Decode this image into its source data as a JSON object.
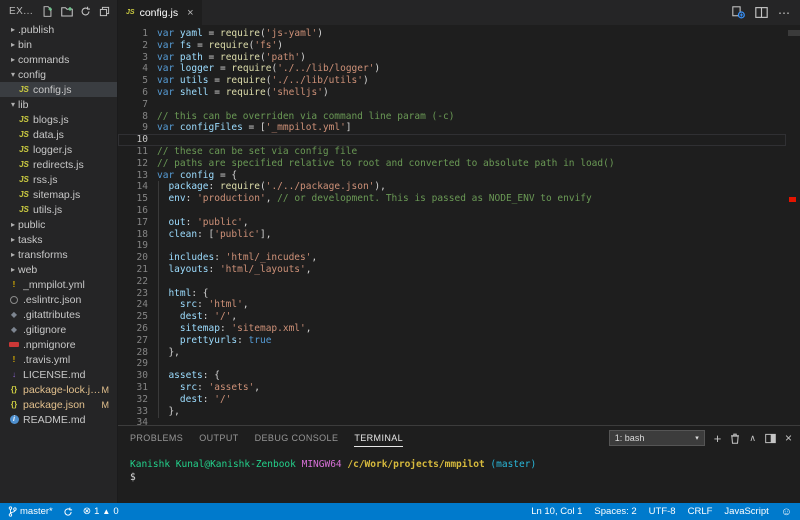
{
  "explorer": {
    "title": "EX...",
    "actions": [
      {
        "name": "new-file-icon"
      },
      {
        "name": "new-folder-icon"
      },
      {
        "name": "refresh-explorer-icon"
      },
      {
        "name": "collapse-folders-icon"
      }
    ],
    "files": [
      {
        "label": ".publish",
        "icon": "folder",
        "chevron": "right",
        "indent": 0
      },
      {
        "label": "bin",
        "icon": "folder",
        "chevron": "right",
        "indent": 0
      },
      {
        "label": "commands",
        "icon": "folder",
        "chevron": "right",
        "indent": 0
      },
      {
        "label": "config",
        "icon": "folder",
        "chevron": "down",
        "indent": 0
      },
      {
        "label": "config.js",
        "icon": "js-icon",
        "indent": 1,
        "selected": true
      },
      {
        "label": "lib",
        "icon": "folder",
        "chevron": "down",
        "indent": 0
      },
      {
        "label": "blogs.js",
        "icon": "js-icon",
        "indent": 1
      },
      {
        "label": "data.js",
        "icon": "js-icon",
        "indent": 1
      },
      {
        "label": "logger.js",
        "icon": "js-icon",
        "indent": 1
      },
      {
        "label": "redirects.js",
        "icon": "js-icon",
        "indent": 1
      },
      {
        "label": "rss.js",
        "icon": "js-icon",
        "indent": 1
      },
      {
        "label": "sitemap.js",
        "icon": "js-icon",
        "indent": 1
      },
      {
        "label": "utils.js",
        "icon": "js-icon",
        "indent": 1
      },
      {
        "label": "public",
        "icon": "folder",
        "chevron": "right",
        "indent": 0
      },
      {
        "label": "tasks",
        "icon": "folder",
        "chevron": "right",
        "indent": 0
      },
      {
        "label": "transforms",
        "icon": "folder",
        "chevron": "right",
        "indent": 0
      },
      {
        "label": "web",
        "icon": "folder",
        "chevron": "right",
        "indent": 0
      },
      {
        "label": "_mmpilot.yml",
        "icon": "warning-icon",
        "indent": 0
      },
      {
        "label": ".eslintrc.json",
        "icon": "gear-icon",
        "indent": 0
      },
      {
        "label": ".gitattributes",
        "icon": "diamond-icon",
        "indent": 0
      },
      {
        "label": ".gitignore",
        "icon": "diamond-icon",
        "indent": 0
      },
      {
        "label": ".npmignore",
        "icon": "npm-icon",
        "indent": 0
      },
      {
        "label": ".travis.yml",
        "icon": "warning-icon",
        "indent": 0
      },
      {
        "label": "LICENSE.md",
        "icon": "license-icon",
        "indent": 0
      },
      {
        "label": "package-lock.json",
        "icon": "braces-icon",
        "indent": 0,
        "badge": "M",
        "modified": true
      },
      {
        "label": "package.json",
        "icon": "braces-icon",
        "indent": 0,
        "badge": "M",
        "modified": true
      },
      {
        "label": "README.md",
        "icon": "info-icon",
        "indent": 0
      }
    ]
  },
  "editor": {
    "tab": {
      "label": "config.js",
      "icon": "js-icon",
      "close": "×"
    },
    "actions": [
      {
        "name": "open-changes-icon"
      },
      {
        "name": "split-editor-icon"
      },
      {
        "name": "more-actions-icon",
        "glyph": "⋯"
      }
    ],
    "current_line": 10,
    "lines": [
      {
        "n": 1,
        "t": [
          [
            "kw",
            "var"
          ],
          [
            "pn",
            " "
          ],
          [
            "var",
            "yaml"
          ],
          [
            "pn",
            " = "
          ],
          [
            "fn",
            "require"
          ],
          [
            "pn",
            "("
          ],
          [
            "str",
            "'js-yaml'"
          ],
          [
            "pn",
            ")"
          ]
        ]
      },
      {
        "n": 2,
        "t": [
          [
            "kw",
            "var"
          ],
          [
            "pn",
            " "
          ],
          [
            "var",
            "fs"
          ],
          [
            "pn",
            " = "
          ],
          [
            "fn",
            "require"
          ],
          [
            "pn",
            "("
          ],
          [
            "str",
            "'fs'"
          ],
          [
            "pn",
            ")"
          ]
        ]
      },
      {
        "n": 3,
        "t": [
          [
            "kw",
            "var"
          ],
          [
            "pn",
            " "
          ],
          [
            "var",
            "path"
          ],
          [
            "pn",
            " = "
          ],
          [
            "fn",
            "require"
          ],
          [
            "pn",
            "("
          ],
          [
            "str",
            "'path'"
          ],
          [
            "pn",
            ")"
          ]
        ]
      },
      {
        "n": 4,
        "t": [
          [
            "kw",
            "var"
          ],
          [
            "pn",
            " "
          ],
          [
            "var",
            "logger"
          ],
          [
            "pn",
            " = "
          ],
          [
            "fn",
            "require"
          ],
          [
            "pn",
            "("
          ],
          [
            "str",
            "'./../lib/logger'"
          ],
          [
            "pn",
            ")"
          ]
        ]
      },
      {
        "n": 5,
        "t": [
          [
            "kw",
            "var"
          ],
          [
            "pn",
            " "
          ],
          [
            "var",
            "utils"
          ],
          [
            "pn",
            " = "
          ],
          [
            "fn",
            "require"
          ],
          [
            "pn",
            "("
          ],
          [
            "str",
            "'./../lib/utils'"
          ],
          [
            "pn",
            ")"
          ]
        ]
      },
      {
        "n": 6,
        "t": [
          [
            "kw",
            "var"
          ],
          [
            "pn",
            " "
          ],
          [
            "var",
            "shell"
          ],
          [
            "pn",
            " = "
          ],
          [
            "fn",
            "require"
          ],
          [
            "pn",
            "("
          ],
          [
            "str",
            "'shelljs'"
          ],
          [
            "pn",
            ")"
          ]
        ]
      },
      {
        "n": 7,
        "t": []
      },
      {
        "n": 8,
        "t": [
          [
            "cm",
            "// this can be overriden via command line param (-c)"
          ]
        ]
      },
      {
        "n": 9,
        "t": [
          [
            "kw",
            "var"
          ],
          [
            "pn",
            " "
          ],
          [
            "var",
            "configFiles"
          ],
          [
            "pn",
            " = ["
          ],
          [
            "str",
            "'_mmpilot.yml'"
          ],
          [
            "pn",
            "]"
          ]
        ]
      },
      {
        "n": 10,
        "t": []
      },
      {
        "n": 11,
        "t": [
          [
            "cm",
            "// these can be set via config file"
          ]
        ]
      },
      {
        "n": 12,
        "t": [
          [
            "cm",
            "// paths are specified relative to root and converted to absolute path in load()"
          ]
        ]
      },
      {
        "n": 13,
        "t": [
          [
            "kw",
            "var"
          ],
          [
            "pn",
            " "
          ],
          [
            "var",
            "config"
          ],
          [
            "pn",
            " = {"
          ]
        ]
      },
      {
        "n": 14,
        "t": [
          [
            "pn",
            "  "
          ],
          [
            "var",
            "package"
          ],
          [
            "pn",
            ": "
          ],
          [
            "fn",
            "require"
          ],
          [
            "pn",
            "("
          ],
          [
            "str",
            "'./../package.json'"
          ],
          [
            "pn",
            "),"
          ]
        ]
      },
      {
        "n": 15,
        "t": [
          [
            "pn",
            "  "
          ],
          [
            "var",
            "env"
          ],
          [
            "pn",
            ": "
          ],
          [
            "str",
            "'production'"
          ],
          [
            "pn",
            ", "
          ],
          [
            "cm",
            "// or development. This is passed as NODE_ENV to envify"
          ]
        ]
      },
      {
        "n": 16,
        "t": []
      },
      {
        "n": 17,
        "t": [
          [
            "pn",
            "  "
          ],
          [
            "var",
            "out"
          ],
          [
            "pn",
            ": "
          ],
          [
            "str",
            "'public'"
          ],
          [
            "pn",
            ","
          ]
        ]
      },
      {
        "n": 18,
        "t": [
          [
            "pn",
            "  "
          ],
          [
            "var",
            "clean"
          ],
          [
            "pn",
            ": ["
          ],
          [
            "str",
            "'public'"
          ],
          [
            "pn",
            "],"
          ]
        ]
      },
      {
        "n": 19,
        "t": []
      },
      {
        "n": 20,
        "t": [
          [
            "pn",
            "  "
          ],
          [
            "var",
            "includes"
          ],
          [
            "pn",
            ": "
          ],
          [
            "str",
            "'html/_incudes'"
          ],
          [
            "pn",
            ","
          ]
        ]
      },
      {
        "n": 21,
        "t": [
          [
            "pn",
            "  "
          ],
          [
            "var",
            "layouts"
          ],
          [
            "pn",
            ": "
          ],
          [
            "str",
            "'html/_layouts'"
          ],
          [
            "pn",
            ","
          ]
        ]
      },
      {
        "n": 22,
        "t": []
      },
      {
        "n": 23,
        "t": [
          [
            "pn",
            "  "
          ],
          [
            "var",
            "html"
          ],
          [
            "pn",
            ": {"
          ]
        ]
      },
      {
        "n": 24,
        "t": [
          [
            "pn",
            "    "
          ],
          [
            "var",
            "src"
          ],
          [
            "pn",
            ": "
          ],
          [
            "str",
            "'html'"
          ],
          [
            "pn",
            ","
          ]
        ]
      },
      {
        "n": 25,
        "t": [
          [
            "pn",
            "    "
          ],
          [
            "var",
            "dest"
          ],
          [
            "pn",
            ": "
          ],
          [
            "str",
            "'/'"
          ],
          [
            "pn",
            ","
          ]
        ]
      },
      {
        "n": 26,
        "t": [
          [
            "pn",
            "    "
          ],
          [
            "var",
            "sitemap"
          ],
          [
            "pn",
            ": "
          ],
          [
            "str",
            "'sitemap.xml'"
          ],
          [
            "pn",
            ","
          ]
        ]
      },
      {
        "n": 27,
        "t": [
          [
            "pn",
            "    "
          ],
          [
            "var",
            "prettyurls"
          ],
          [
            "pn",
            ": "
          ],
          [
            "kw",
            "true"
          ]
        ]
      },
      {
        "n": 28,
        "t": [
          [
            "pn",
            "  },"
          ]
        ]
      },
      {
        "n": 29,
        "t": []
      },
      {
        "n": 30,
        "t": [
          [
            "pn",
            "  "
          ],
          [
            "var",
            "assets"
          ],
          [
            "pn",
            ": {"
          ]
        ]
      },
      {
        "n": 31,
        "t": [
          [
            "pn",
            "    "
          ],
          [
            "var",
            "src"
          ],
          [
            "pn",
            ": "
          ],
          [
            "str",
            "'assets'"
          ],
          [
            "pn",
            ","
          ]
        ]
      },
      {
        "n": 32,
        "t": [
          [
            "pn",
            "    "
          ],
          [
            "var",
            "dest"
          ],
          [
            "pn",
            ": "
          ],
          [
            "str",
            "'/'"
          ]
        ]
      },
      {
        "n": 33,
        "t": [
          [
            "pn",
            "  },"
          ]
        ]
      },
      {
        "n": 34,
        "t": []
      }
    ]
  },
  "panel": {
    "tabs": [
      "PROBLEMS",
      "OUTPUT",
      "DEBUG CONSOLE",
      "TERMINAL"
    ],
    "active_tab": "TERMINAL",
    "shell_select": "1: bash",
    "actions": [
      {
        "name": "new-terminal-icon",
        "glyph": "+"
      },
      {
        "name": "kill-terminal-icon",
        "glyph": "trash"
      },
      {
        "name": "maximize-panel-icon",
        "glyph": "∧"
      },
      {
        "name": "split-terminal-icon",
        "glyph": "split"
      },
      {
        "name": "close-panel-icon",
        "glyph": "×"
      }
    ]
  },
  "terminal": {
    "prompt_user": "Kanishk Kunal@Kanishk-Zenbook",
    "prompt_sys": "MINGW64",
    "prompt_path": "/c/Work/projects/mmpilot",
    "prompt_branch": "(master)",
    "prompt_symbol": "$"
  },
  "statusbar": {
    "branch": "master*",
    "errors": "1",
    "warnings": "0",
    "line_col": "Ln 10, Col 1",
    "spaces": "Spaces: 2",
    "encoding": "UTF-8",
    "eol": "CRLF",
    "language": "JavaScript"
  },
  "colors": {
    "statusbar": "#007acc",
    "modified_file": "#e2c08d",
    "error_marker": "#e51400",
    "editor_bg": "#1e1e1e",
    "sidebar_bg": "#252526"
  }
}
